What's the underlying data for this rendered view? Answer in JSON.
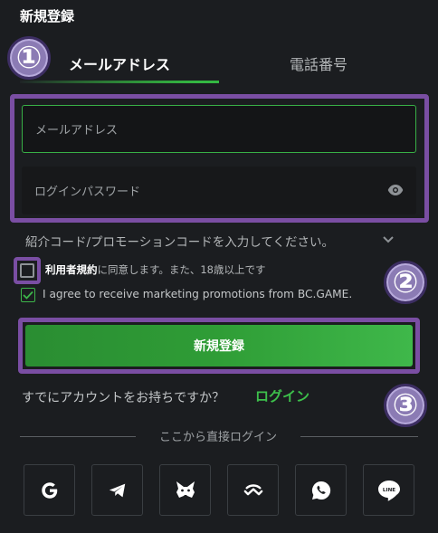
{
  "header": {
    "title": "新規登録"
  },
  "tabs": [
    {
      "label": "メールアドレス",
      "active": true
    },
    {
      "label": "電話番号",
      "active": false
    }
  ],
  "annotations": [
    "①",
    "②",
    "③"
  ],
  "form": {
    "email_placeholder": "メールアドレス",
    "password_placeholder": "ログインパスワード",
    "promo_label": "紹介コード/プロモーションコードを入力してください。",
    "terms_bold": "利用者規約",
    "terms_rest": "に同意します。また、18歳以上です",
    "marketing_label": "I agree to receive marketing promotions from BC.GAME.",
    "register_button": "新規登録",
    "have_account": "すでにアカウントをお持ちですか？",
    "login_link": "ログイン"
  },
  "social": {
    "divider_label": "ここから直接ログイン",
    "providers": [
      "google-icon",
      "telegram-icon",
      "metamask-icon",
      "walletconnect-icon",
      "whatsapp-icon",
      "line-icon"
    ],
    "line_text": "LINE"
  },
  "colors": {
    "accent": "#3dc04b",
    "background": "#1b1d20",
    "annotation": "#7a4ea3"
  }
}
